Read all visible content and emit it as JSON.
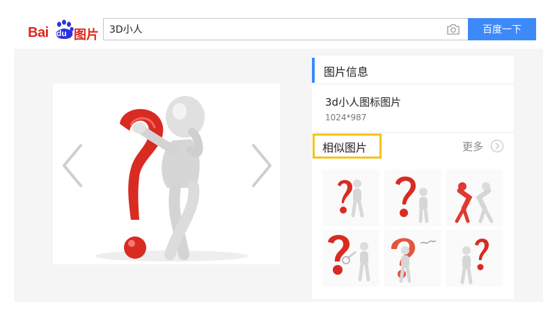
{
  "logo": {
    "part1": "Bai",
    "part2": "du",
    "part3": "图片"
  },
  "search": {
    "query": "3D小人",
    "button_label": "百度一下"
  },
  "info": {
    "section_title": "图片信息",
    "image_name": "3d小人图标图片",
    "image_size": "1024*987"
  },
  "similar": {
    "title": "相似图片",
    "more_label": "更多"
  },
  "colors": {
    "brand_red": "#e1251b",
    "accent_blue": "#3e89fa",
    "highlight_yellow": "#f7c21b",
    "question_red": "#d92b22"
  }
}
